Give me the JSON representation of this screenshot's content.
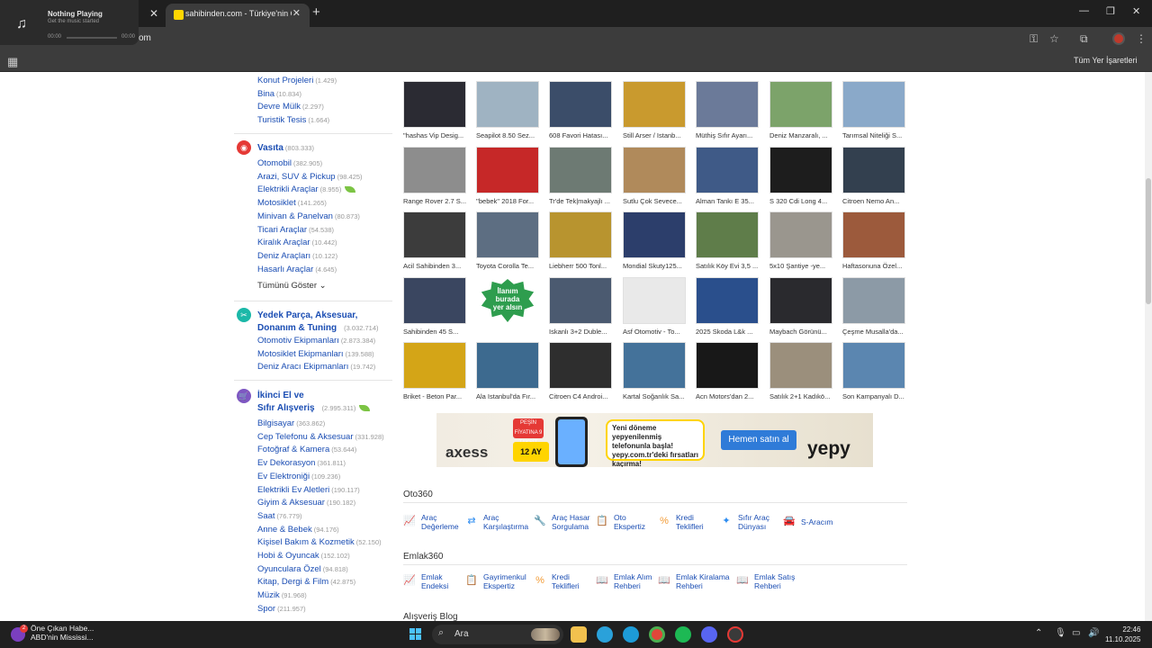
{
  "browser": {
    "media": {
      "title": "Nothing Playing",
      "subtitle": "Get the music started",
      "time_start": "00:00",
      "time_end": "00:00"
    },
    "tab_title": "sahibinden.com - Türkiye'nin O",
    "url_fragment": "om",
    "bookmarks_folder": "Tüm Yer İşaretleri"
  },
  "sidebar": {
    "emlak_items": [
      {
        "label": "Konut Projeleri",
        "count": "(1.429)"
      },
      {
        "label": "Bina",
        "count": "(10.834)"
      },
      {
        "label": "Devre Mülk",
        "count": "(2.297)"
      },
      {
        "label": "Turistik Tesis",
        "count": "(1.664)"
      }
    ],
    "vasita": {
      "title": "Vasıta",
      "count": "(803.333)",
      "items": [
        {
          "label": "Otomobil",
          "count": "(382.905)"
        },
        {
          "label": "Arazi, SUV & Pickup",
          "count": "(98.425)"
        },
        {
          "label": "Elektrikli Araçlar",
          "count": "(8.955)"
        },
        {
          "label": "Motosiklet",
          "count": "(141.265)"
        },
        {
          "label": "Minivan & Panelvan",
          "count": "(80.873)"
        },
        {
          "label": "Ticari Araçlar",
          "count": "(54.538)"
        },
        {
          "label": "Kiralık Araçlar",
          "count": "(10.442)"
        },
        {
          "label": "Deniz Araçları",
          "count": "(10.122)"
        },
        {
          "label": "Hasarlı Araçlar",
          "count": "(4.645)"
        }
      ],
      "show_all": "Tümünü Göster"
    },
    "yedek": {
      "title_line1": "Yedek Parça, Aksesuar,",
      "title_line2": "Donanım & Tuning",
      "count": "(3.032.714)",
      "items": [
        {
          "label": "Otomotiv Ekipmanları",
          "count": "(2.873.384)"
        },
        {
          "label": "Motosiklet Ekipmanları",
          "count": "(139.588)"
        },
        {
          "label": "Deniz Aracı Ekipmanları",
          "count": "(19.742)"
        }
      ]
    },
    "ikinci": {
      "title_line1": "İkinci El ve",
      "title_line2": "Sıfır Alışveriş",
      "count": "(2.995.311)",
      "items": [
        {
          "label": "Bilgisayar",
          "count": "(363.862)"
        },
        {
          "label": "Cep Telefonu & Aksesuar",
          "count": "(331.928)"
        },
        {
          "label": "Fotoğraf & Kamera",
          "count": "(53.644)"
        },
        {
          "label": "Ev Dekorasyon",
          "count": "(361.811)"
        },
        {
          "label": "Ev Elektroniği",
          "count": "(109.236)"
        },
        {
          "label": "Elektrikli Ev Aletleri",
          "count": "(190.117)"
        },
        {
          "label": "Giyim & Aksesuar",
          "count": "(190.182)"
        },
        {
          "label": "Saat",
          "count": "(76.779)"
        },
        {
          "label": "Anne & Bebek",
          "count": "(94.176)"
        },
        {
          "label": "Kişisel Bakım & Kozmetik",
          "count": "(52.150)"
        },
        {
          "label": "Hobi & Oyuncak",
          "count": "(152.102)"
        },
        {
          "label": "Oyunculara Özel",
          "count": "(94.818)"
        },
        {
          "label": "Kitap, Dergi & Film",
          "count": "(42.875)"
        },
        {
          "label": "Müzik",
          "count": "(91.968)"
        },
        {
          "label": "Spor",
          "count": "(211.957)"
        }
      ]
    }
  },
  "showcase": [
    {
      "caption": "\"hashas Vip Desig...",
      "color": "#2b2b33"
    },
    {
      "caption": "Seapilot 8.50 Sez...",
      "color": "#9fb3c2"
    },
    {
      "caption": "608 Favori Hatası...",
      "color": "#3b4d69"
    },
    {
      "caption": "Still Arser / Istanb...",
      "color": "#c99a2e"
    },
    {
      "caption": "Müthiş Sıfır Ayarı...",
      "color": "#6b7a99"
    },
    {
      "caption": "Deniz Manzaralı, ...",
      "color": "#7ca36a"
    },
    {
      "caption": "Tarımsal Niteliği S...",
      "color": "#8aa9c9"
    },
    {
      "caption": "Range Rover 2.7 S...",
      "color": "#8d8d8d"
    },
    {
      "caption": "''bebek'' 2018 For...",
      "color": "#c62828"
    },
    {
      "caption": "Tr'de Tek|makyajlı ...",
      "color": "#6d7a73"
    },
    {
      "caption": "Sutlu Çok Sevece...",
      "color": "#b08a5b"
    },
    {
      "caption": "Alman Tankı E 35...",
      "color": "#3f5a87"
    },
    {
      "caption": "S 320 Cdi Long 4...",
      "color": "#1d1d1d"
    },
    {
      "caption": "Citroen Nemo An...",
      "color": "#33404f"
    },
    {
      "caption": "Acil Sahibinden 3...",
      "color": "#3c3c3c"
    },
    {
      "caption": "Toyota Corolla Te...",
      "color": "#5d6e82"
    },
    {
      "caption": "Liebherr 500 Tonl...",
      "color": "#b8942f"
    },
    {
      "caption": "Mondial Skuty125...",
      "color": "#2c3e6b"
    },
    {
      "caption": "Satılık Köy Evi 3,5 ...",
      "color": "#5f7d4a"
    },
    {
      "caption": "5x10 Şantiye -ye...",
      "color": "#9a968e"
    },
    {
      "caption": "Haftasonuna Özel...",
      "color": "#9c5a3c"
    },
    {
      "caption": "Sahibinden 45 S...",
      "color": "#3a4660"
    },
    {
      "caption": "",
      "color": "#ffffff",
      "badge": true
    },
    {
      "caption": "Iskanlı 3+2 Duble...",
      "color": "#4b5a70"
    },
    {
      "caption": "Asf Otomotiv - To...",
      "color": "#e9e9e9"
    },
    {
      "caption": "2025 Skoda L&k ...",
      "color": "#2a4f8c"
    },
    {
      "caption": "Maybach Görünü...",
      "color": "#2a2a2e"
    },
    {
      "caption": "Çeşme Musalla'da...",
      "color": "#8c9aa6"
    },
    {
      "caption": "Briket - Beton Par...",
      "color": "#d4a517"
    },
    {
      "caption": "Ala Istanbul'da Fır...",
      "color": "#3d6a8f"
    },
    {
      "caption": "Citroen C4 Androi...",
      "color": "#2e2e2e"
    },
    {
      "caption": "Kartal Soğanlık Sa...",
      "color": "#44729a"
    },
    {
      "caption": "Acn Motors'dan 2...",
      "color": "#181818"
    },
    {
      "caption": "Satılık 2+1 Kadıkö...",
      "color": "#9b8f7c"
    },
    {
      "caption": "Son Kampanyalı D...",
      "color": "#5b86b0"
    }
  ],
  "badge": {
    "line1": "İlanım",
    "line2": "burada",
    "line3": "yer alsın"
  },
  "banner": {
    "brand_left": "axess",
    "taksit": "PEŞİN FİYATINA 9 TAKSİT",
    "garanti": "12 AY",
    "message": "Yeni döneme yepyenilenmiş telefonunla başla! yepy.com.tr'deki fırsatları kaçırma!",
    "button": "Hemen satın al",
    "brand_right": "yepy"
  },
  "oto360": {
    "title": "Oto360",
    "tools": [
      {
        "line1": "Araç",
        "line2": "Değerleme",
        "icon": "chart-icon"
      },
      {
        "line1": "Araç",
        "line2": "Karşılaştırma",
        "icon": "swap-icon"
      },
      {
        "line1": "Araç Hasar",
        "line2": "Sorgulama",
        "icon": "wrench-icon"
      },
      {
        "line1": "Oto",
        "line2": "Ekspertiz",
        "icon": "clipboard-icon"
      },
      {
        "line1": "Kredi",
        "line2": "Teklifleri",
        "icon": "percent-icon"
      },
      {
        "line1": "Sıfır Araç",
        "line2": "Dünyası",
        "icon": "sparkle-icon"
      },
      {
        "line1": "S-Aracım",
        "line2": "",
        "icon": "car-icon"
      }
    ]
  },
  "emlak360": {
    "title": "Emlak360",
    "tools": [
      {
        "line1": "Emlak",
        "line2": "Endeksi",
        "icon": "chart-icon"
      },
      {
        "line1": "Gayrimenkul",
        "line2": "Ekspertiz",
        "icon": "clipboard-icon"
      },
      {
        "line1": "Kredi",
        "line2": "Teklifleri",
        "icon": "percent-icon"
      },
      {
        "line1": "Emlak Alım",
        "line2": "Rehberi",
        "icon": "book-icon"
      },
      {
        "line1": "Emlak Kiralama",
        "line2": "Rehberi",
        "icon": "book-icon"
      },
      {
        "line1": "Emlak Satış",
        "line2": "Rehberi",
        "icon": "book-icon"
      }
    ]
  },
  "blog_title": "Alışveriş Blog",
  "taskbar": {
    "news_line1": "Öne Çıkan Habe...",
    "news_line2": "ABD'nin Mississi...",
    "news_badge": "2",
    "search": "Ara",
    "time": "22:46",
    "date": "11.10.2025"
  }
}
